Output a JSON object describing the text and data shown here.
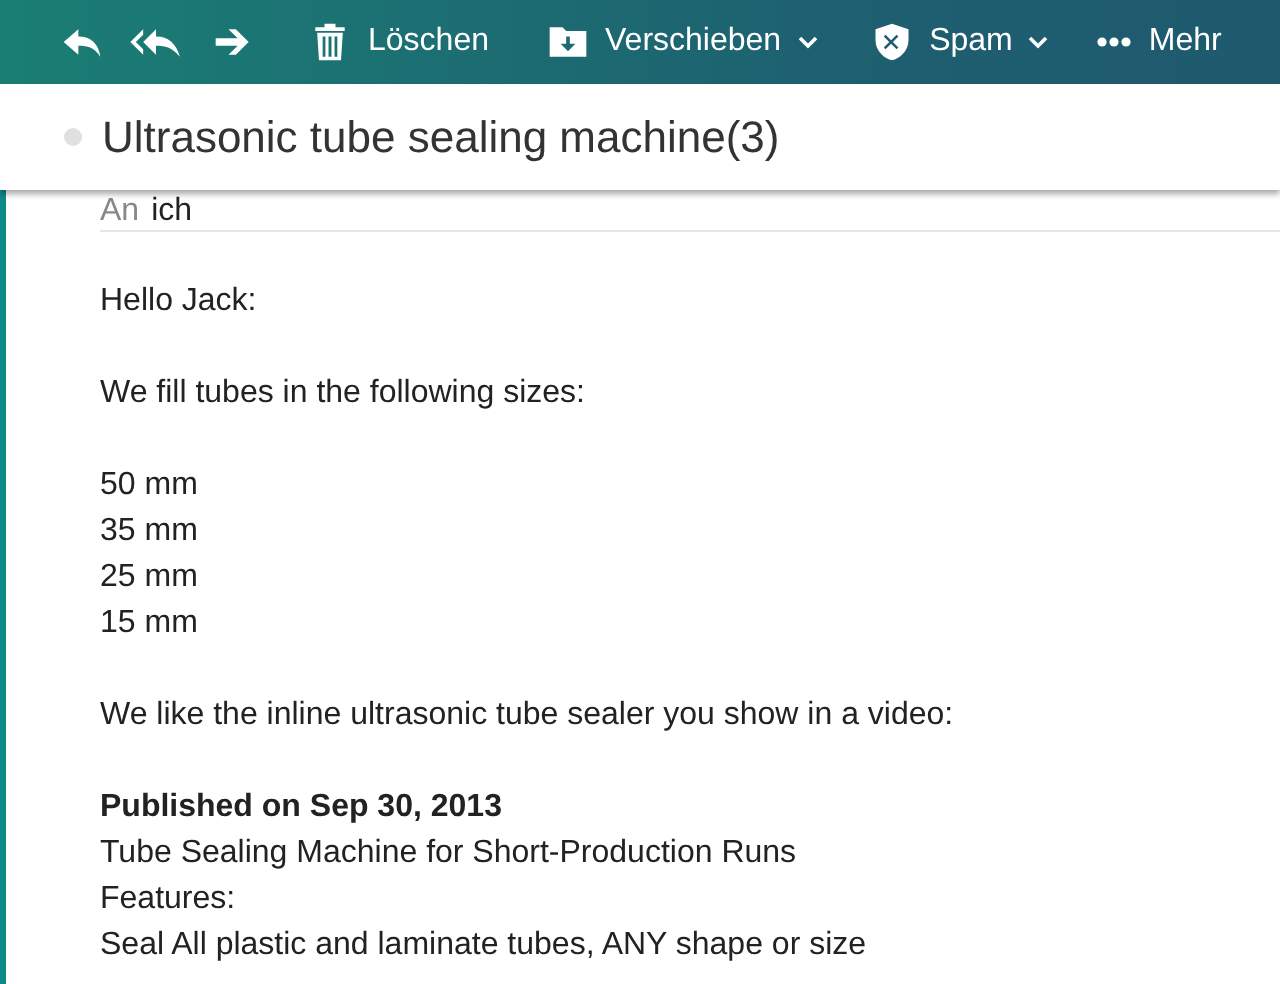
{
  "toolbar": [
    {
      "kind": "reply"
    },
    {
      "kind": "reply-all"
    },
    {
      "kind": "forward"
    },
    {
      "kind": "delete",
      "label": "Löschen"
    },
    {
      "kind": "move",
      "label": "Verschieben",
      "dropdown": true
    },
    {
      "kind": "spam",
      "label": "Spam",
      "dropdown": true
    },
    {
      "kind": "more",
      "label": "Mehr"
    }
  ],
  "subject": "Ultrasonic tube sealing machine(3)",
  "recipient": {
    "label": "An",
    "name": "ich"
  },
  "body": [
    [
      {
        "text": "Hello Jack:",
        "bold": false
      }
    ],
    [
      {
        "text": "We fill tubes in the following sizes:",
        "bold": false
      }
    ],
    [
      {
        "text": "50 mm",
        "bold": false
      },
      {
        "text": "35 mm",
        "bold": false
      },
      {
        "text": "25 mm",
        "bold": false
      },
      {
        "text": "15 mm",
        "bold": false
      }
    ],
    [
      {
        "text": "We like the inline ultrasonic tube sealer you show in a video:",
        "bold": false
      }
    ],
    [
      {
        "text": "Published on Sep 30, 2013",
        "bold": true
      },
      {
        "text": "Tube Sealing Machine for Short-Production Runs",
        "bold": false
      },
      {
        "text": "Features:",
        "bold": false
      },
      {
        "text": "Seal All plastic and laminate tubes, ANY shape or size",
        "bold": false
      }
    ]
  ]
}
